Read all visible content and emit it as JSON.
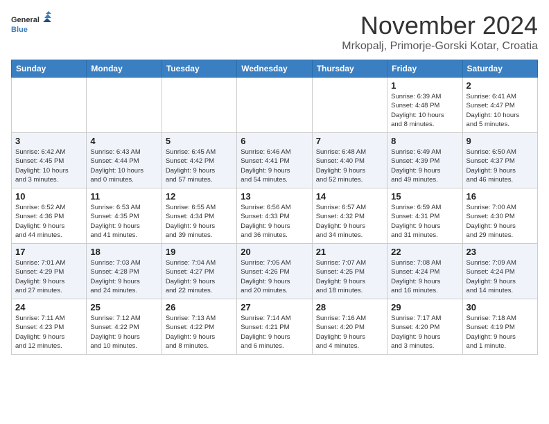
{
  "header": {
    "logo_general": "General",
    "logo_blue": "Blue",
    "month_title": "November 2024",
    "location": "Mrkopalj, Primorje-Gorski Kotar, Croatia"
  },
  "days_of_week": [
    "Sunday",
    "Monday",
    "Tuesday",
    "Wednesday",
    "Thursday",
    "Friday",
    "Saturday"
  ],
  "weeks": [
    [
      {
        "day": "",
        "info": ""
      },
      {
        "day": "",
        "info": ""
      },
      {
        "day": "",
        "info": ""
      },
      {
        "day": "",
        "info": ""
      },
      {
        "day": "",
        "info": ""
      },
      {
        "day": "1",
        "info": "Sunrise: 6:39 AM\nSunset: 4:48 PM\nDaylight: 10 hours\nand 8 minutes."
      },
      {
        "day": "2",
        "info": "Sunrise: 6:41 AM\nSunset: 4:47 PM\nDaylight: 10 hours\nand 5 minutes."
      }
    ],
    [
      {
        "day": "3",
        "info": "Sunrise: 6:42 AM\nSunset: 4:45 PM\nDaylight: 10 hours\nand 3 minutes."
      },
      {
        "day": "4",
        "info": "Sunrise: 6:43 AM\nSunset: 4:44 PM\nDaylight: 10 hours\nand 0 minutes."
      },
      {
        "day": "5",
        "info": "Sunrise: 6:45 AM\nSunset: 4:42 PM\nDaylight: 9 hours\nand 57 minutes."
      },
      {
        "day": "6",
        "info": "Sunrise: 6:46 AM\nSunset: 4:41 PM\nDaylight: 9 hours\nand 54 minutes."
      },
      {
        "day": "7",
        "info": "Sunrise: 6:48 AM\nSunset: 4:40 PM\nDaylight: 9 hours\nand 52 minutes."
      },
      {
        "day": "8",
        "info": "Sunrise: 6:49 AM\nSunset: 4:39 PM\nDaylight: 9 hours\nand 49 minutes."
      },
      {
        "day": "9",
        "info": "Sunrise: 6:50 AM\nSunset: 4:37 PM\nDaylight: 9 hours\nand 46 minutes."
      }
    ],
    [
      {
        "day": "10",
        "info": "Sunrise: 6:52 AM\nSunset: 4:36 PM\nDaylight: 9 hours\nand 44 minutes."
      },
      {
        "day": "11",
        "info": "Sunrise: 6:53 AM\nSunset: 4:35 PM\nDaylight: 9 hours\nand 41 minutes."
      },
      {
        "day": "12",
        "info": "Sunrise: 6:55 AM\nSunset: 4:34 PM\nDaylight: 9 hours\nand 39 minutes."
      },
      {
        "day": "13",
        "info": "Sunrise: 6:56 AM\nSunset: 4:33 PM\nDaylight: 9 hours\nand 36 minutes."
      },
      {
        "day": "14",
        "info": "Sunrise: 6:57 AM\nSunset: 4:32 PM\nDaylight: 9 hours\nand 34 minutes."
      },
      {
        "day": "15",
        "info": "Sunrise: 6:59 AM\nSunset: 4:31 PM\nDaylight: 9 hours\nand 31 minutes."
      },
      {
        "day": "16",
        "info": "Sunrise: 7:00 AM\nSunset: 4:30 PM\nDaylight: 9 hours\nand 29 minutes."
      }
    ],
    [
      {
        "day": "17",
        "info": "Sunrise: 7:01 AM\nSunset: 4:29 PM\nDaylight: 9 hours\nand 27 minutes."
      },
      {
        "day": "18",
        "info": "Sunrise: 7:03 AM\nSunset: 4:28 PM\nDaylight: 9 hours\nand 24 minutes."
      },
      {
        "day": "19",
        "info": "Sunrise: 7:04 AM\nSunset: 4:27 PM\nDaylight: 9 hours\nand 22 minutes."
      },
      {
        "day": "20",
        "info": "Sunrise: 7:05 AM\nSunset: 4:26 PM\nDaylight: 9 hours\nand 20 minutes."
      },
      {
        "day": "21",
        "info": "Sunrise: 7:07 AM\nSunset: 4:25 PM\nDaylight: 9 hours\nand 18 minutes."
      },
      {
        "day": "22",
        "info": "Sunrise: 7:08 AM\nSunset: 4:24 PM\nDaylight: 9 hours\nand 16 minutes."
      },
      {
        "day": "23",
        "info": "Sunrise: 7:09 AM\nSunset: 4:24 PM\nDaylight: 9 hours\nand 14 minutes."
      }
    ],
    [
      {
        "day": "24",
        "info": "Sunrise: 7:11 AM\nSunset: 4:23 PM\nDaylight: 9 hours\nand 12 minutes."
      },
      {
        "day": "25",
        "info": "Sunrise: 7:12 AM\nSunset: 4:22 PM\nDaylight: 9 hours\nand 10 minutes."
      },
      {
        "day": "26",
        "info": "Sunrise: 7:13 AM\nSunset: 4:22 PM\nDaylight: 9 hours\nand 8 minutes."
      },
      {
        "day": "27",
        "info": "Sunrise: 7:14 AM\nSunset: 4:21 PM\nDaylight: 9 hours\nand 6 minutes."
      },
      {
        "day": "28",
        "info": "Sunrise: 7:16 AM\nSunset: 4:20 PM\nDaylight: 9 hours\nand 4 minutes."
      },
      {
        "day": "29",
        "info": "Sunrise: 7:17 AM\nSunset: 4:20 PM\nDaylight: 9 hours\nand 3 minutes."
      },
      {
        "day": "30",
        "info": "Sunrise: 7:18 AM\nSunset: 4:19 PM\nDaylight: 9 hours\nand 1 minute."
      }
    ]
  ]
}
